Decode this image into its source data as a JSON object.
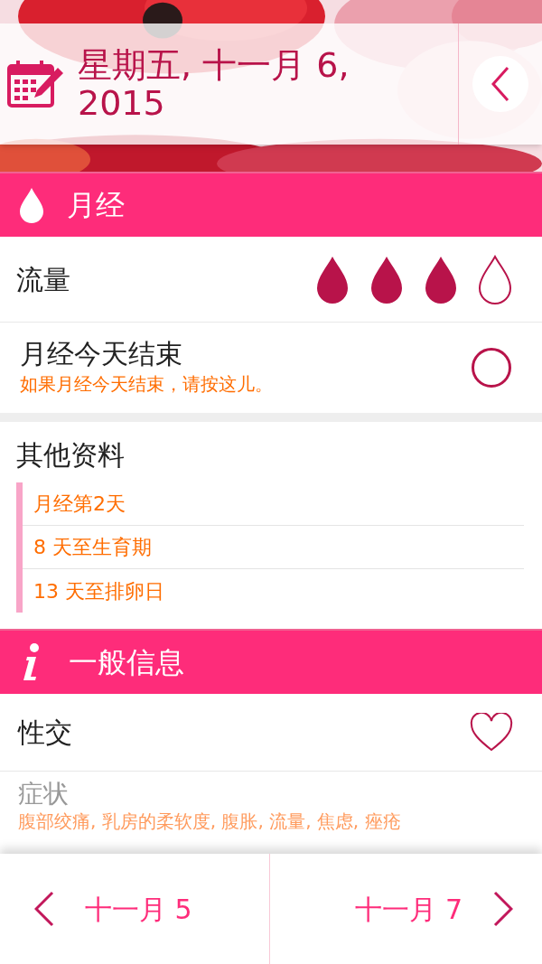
{
  "header": {
    "date": "星期五, 十一月 6, 2015"
  },
  "period": {
    "title": "月经",
    "flow": {
      "label": "流量",
      "stars": 3
    },
    "ends_today": {
      "label": "月经今天结束",
      "hint": "如果月经今天结束，请按这儿。",
      "checked": false
    }
  },
  "other_info": {
    "title": "其他资料",
    "items": [
      "月经第2天",
      "8 天至生育期",
      "13 天至排卵日"
    ]
  },
  "general": {
    "title": "一般信息",
    "intercourse": {
      "label": "性交",
      "checked": false
    },
    "symptoms": {
      "label": "症状",
      "value": "腹部绞痛, 乳房的柔软度, 腹胀, 流量, 焦虑, 痤疮"
    }
  },
  "nav": {
    "prev": "十一月 5",
    "next": "十一月 7"
  }
}
